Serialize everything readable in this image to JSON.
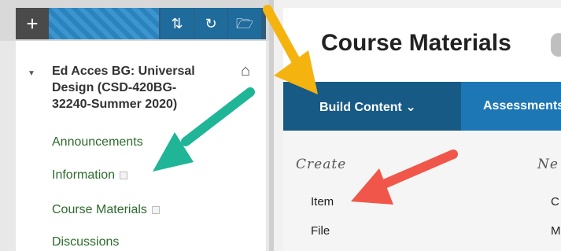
{
  "toolbar": {
    "plus": "+",
    "sort": "⇅",
    "refresh": "↻",
    "folder": "🗁"
  },
  "course": {
    "title": "Ed Acces BG: Universal\nDesign (CSD-420BG-\n32240-Summer 2020)",
    "home_icon": "⌂"
  },
  "nav": [
    {
      "label": "Announcements"
    },
    {
      "label": "Information"
    },
    {
      "label": "Course Materials"
    },
    {
      "label": "Discussions"
    }
  ],
  "main": {
    "page_title": "Course Materials",
    "tabs": [
      {
        "label": "Build Content ⌄"
      },
      {
        "label": "Assessments"
      }
    ]
  },
  "dropdown": {
    "create_header": "Create",
    "new_header": "Ne",
    "create_items": [
      "Item",
      "File"
    ],
    "right_items": [
      "C",
      "M"
    ]
  },
  "annotations": {
    "arrow_colors": {
      "yellow": "#f5b30f",
      "teal": "#1fb596",
      "red": "#f0574a"
    }
  }
}
